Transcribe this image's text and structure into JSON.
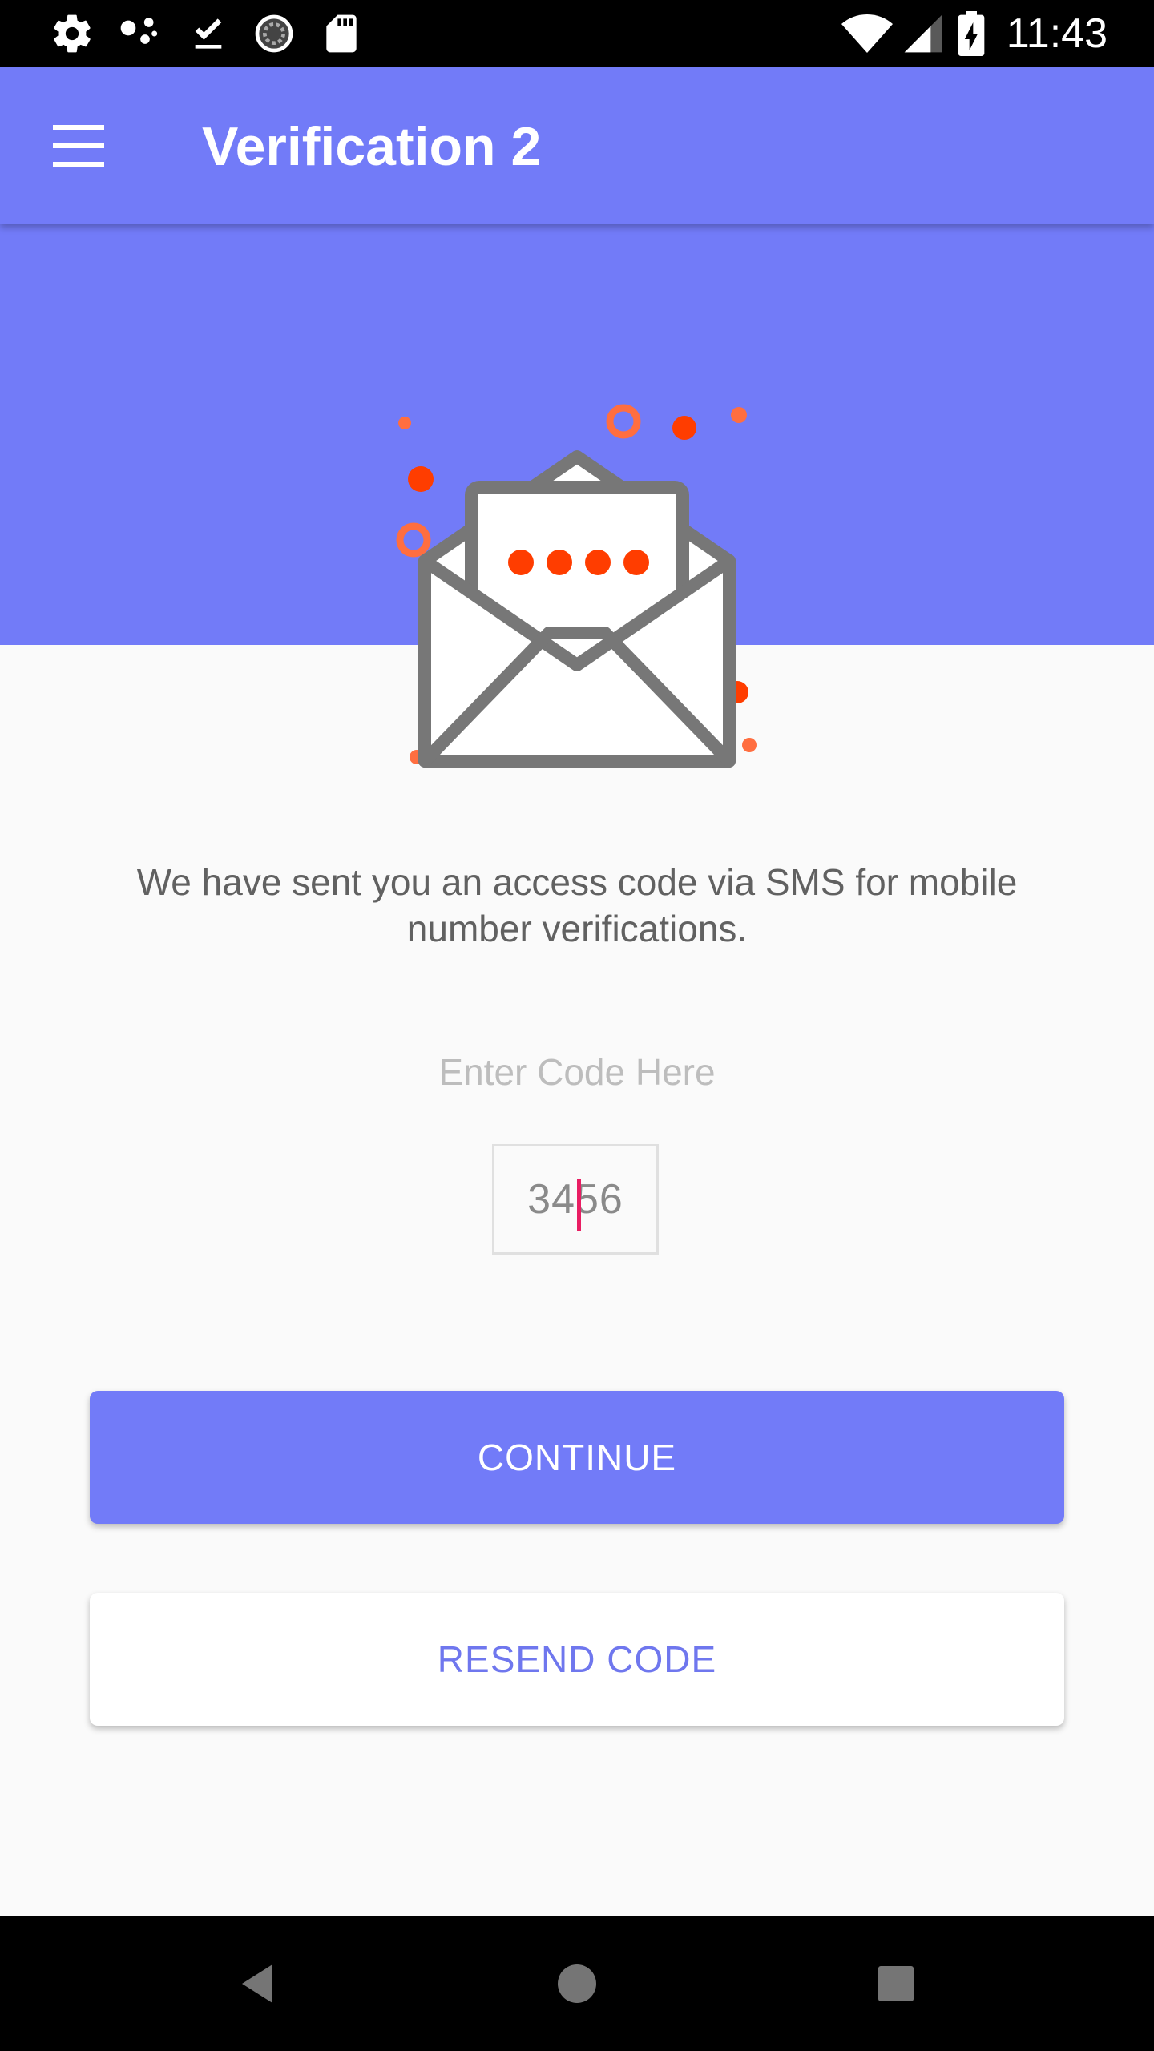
{
  "status_bar": {
    "time": "11:43",
    "left_icons": [
      "settings-icon",
      "connections-icon",
      "download-done-icon",
      "sync-icon",
      "sd-card-icon"
    ],
    "right_icons": [
      "wifi-icon",
      "signal-icon",
      "battery-charging-icon"
    ]
  },
  "app_bar": {
    "title": "Verification 2",
    "menu_icon": "menu-icon"
  },
  "content": {
    "illustration": "open-envelope-code-icon",
    "message": "We have sent you an access code via SMS for mobile number verifications.",
    "code_label": "Enter Code Here",
    "code_value": "3456"
  },
  "buttons": {
    "continue_label": "CONTINUE",
    "resend_label": "RESEND CODE"
  },
  "nav_bar": {
    "icons": [
      "back-icon",
      "home-icon",
      "recents-icon"
    ]
  },
  "colors": {
    "primary": "#727bf8",
    "accent_dots": "#ff3d00",
    "caret": "#e91e63",
    "background": "#fafafa"
  }
}
